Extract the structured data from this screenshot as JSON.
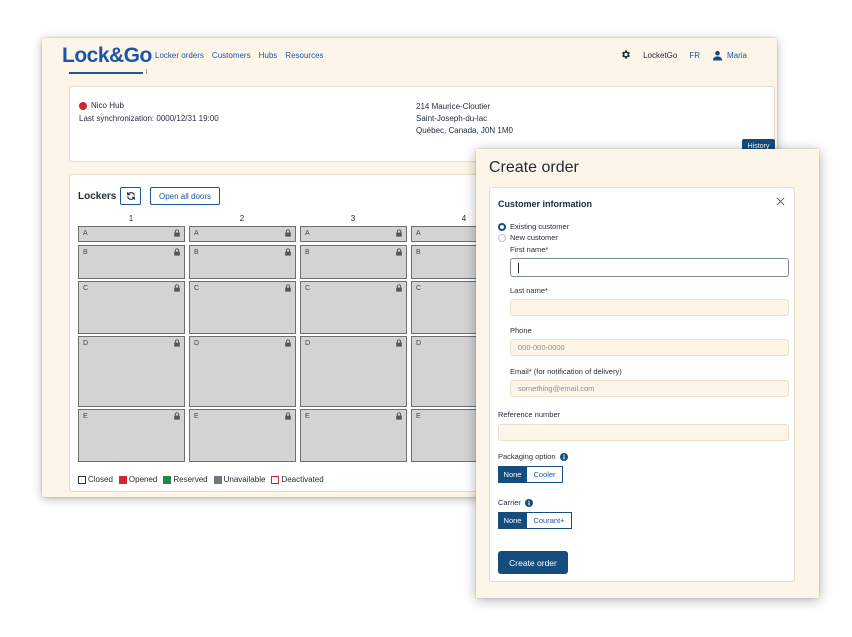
{
  "nav": {
    "logo": "Lock&Go",
    "links": [
      "Locker orders",
      "Customers",
      "Hubs",
      "Resources"
    ],
    "account": "LocketGo",
    "language": "FR",
    "user": "Maria"
  },
  "hub": {
    "name": "Nico Hub",
    "status_color": "#d0262f",
    "last_sync": "Last synchronization: 0000/12/31 19:00",
    "address_line1": "214 Maurice-Cloutier",
    "address_line2": "Saint-Joseph-du-lac",
    "address_line3": "Québec, Canada, J0N 1M0",
    "history_label": "History"
  },
  "lockers": {
    "title": "Lockers",
    "open_all_label": "Open all doors",
    "columns": [
      "1",
      "2",
      "3",
      "4"
    ],
    "rows": [
      "A",
      "B",
      "C",
      "D",
      "E"
    ],
    "legend": [
      {
        "label": "Closed",
        "color": "#ffffff",
        "border": "#333333"
      },
      {
        "label": "Opened",
        "color": "#d0262f",
        "border": "#d0262f"
      },
      {
        "label": "Reserved",
        "color": "#1e8a4a",
        "border": "#1e8a4a"
      },
      {
        "label": "Unavailable",
        "color": "#6f7780",
        "border": "#6f7780"
      },
      {
        "label": "Deactivated",
        "color": "#ffffff",
        "border": "#d0262f"
      }
    ]
  },
  "modal": {
    "title": "Create order",
    "section_title": "Customer information",
    "radio_existing": "Existing customer",
    "radio_new": "New customer",
    "first_name_label": "First name*",
    "first_name_value": "",
    "last_name_label": "Last name*",
    "last_name_value": "",
    "phone_label": "Phone",
    "phone_placeholder": "000-000-0000",
    "email_label": "Email* (for notification of delivery)",
    "email_placeholder": "something@email.com",
    "reference_label": "Reference number",
    "reference_value": "",
    "packaging_label": "Packaging option",
    "packaging_options": [
      "None",
      "Cooler"
    ],
    "packaging_selected": "None",
    "carrier_label": "Carrier",
    "carrier_options": [
      "None",
      "Courant+"
    ],
    "carrier_selected": "None",
    "create_label": "Create order"
  },
  "colors": {
    "brand": "#1b56a6",
    "primary_button": "#154d7e",
    "background": "#fdf5e8",
    "locker_cell": "#d3d3d3"
  }
}
